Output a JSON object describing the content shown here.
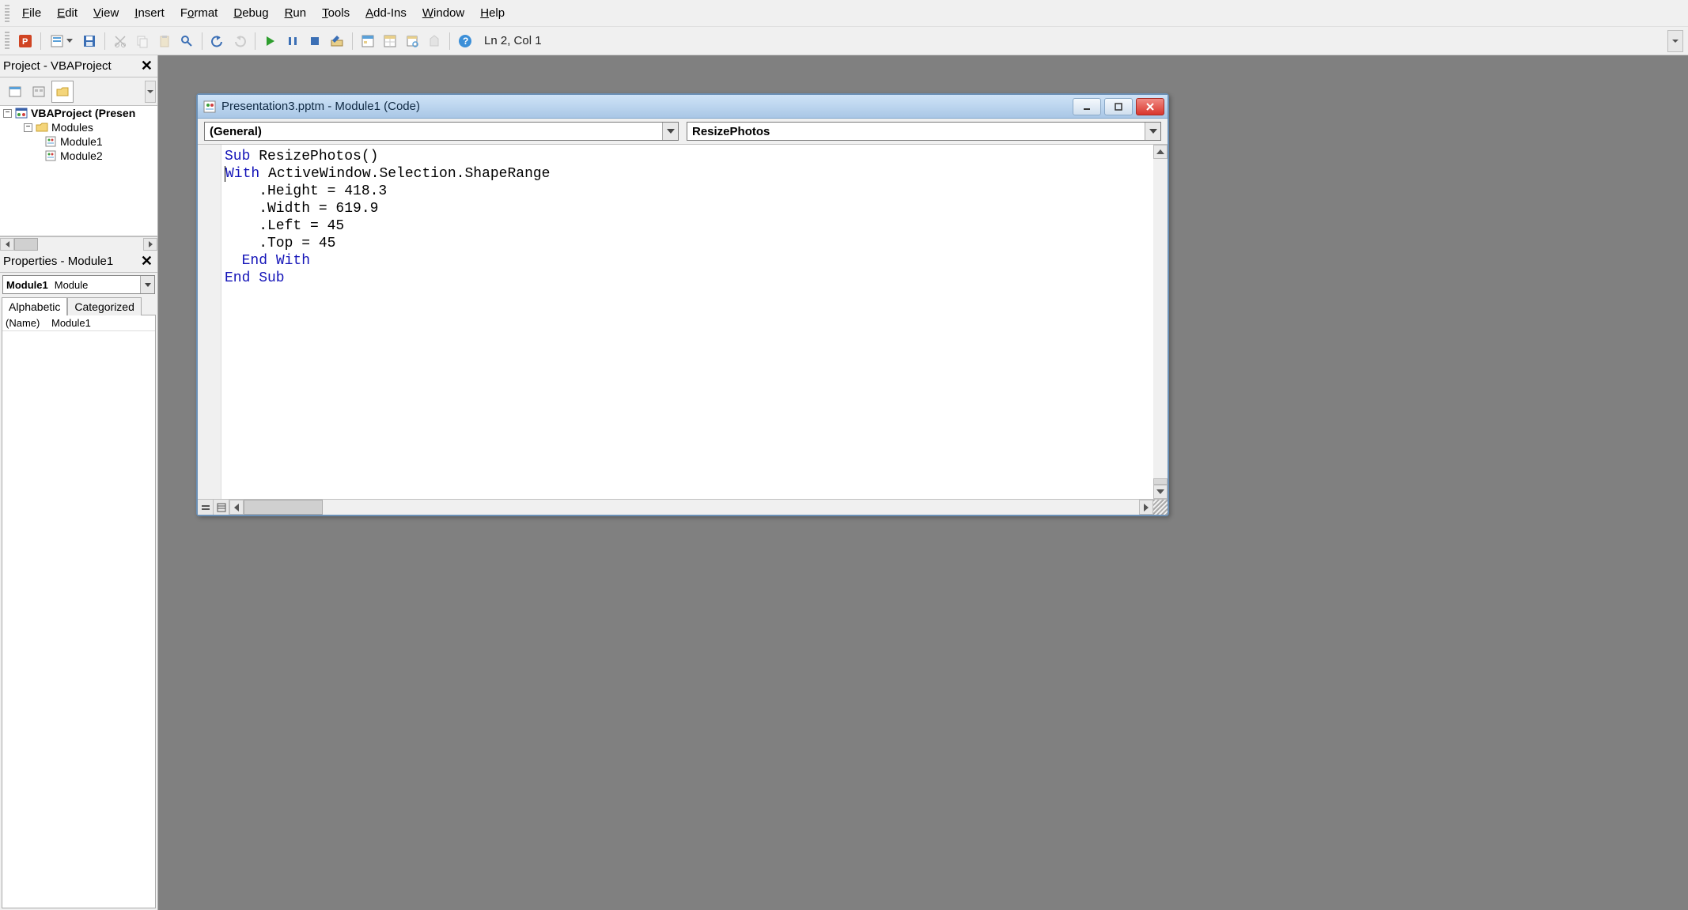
{
  "menu": {
    "file": "File",
    "edit": "Edit",
    "view": "View",
    "insert": "Insert",
    "format": "Format",
    "debug": "Debug",
    "run": "Run",
    "tools": "Tools",
    "addins": "Add-Ins",
    "window": "Window",
    "help": "Help"
  },
  "toolbar": {
    "status": "Ln 2, Col 1"
  },
  "project_panel": {
    "title": "Project - VBAProject",
    "tree": {
      "root": "VBAProject (Presen",
      "folder": "Modules",
      "module1": "Module1",
      "module2": "Module2"
    }
  },
  "properties_panel": {
    "title": "Properties - Module1",
    "object_name": "Module1",
    "object_type": "Module",
    "tabs": {
      "alphabetic": "Alphabetic",
      "categorized": "Categorized"
    },
    "rows": [
      {
        "name": "(Name)",
        "value": "Module1"
      }
    ]
  },
  "code_window": {
    "title": "Presentation3.pptm - Module1 (Code)",
    "combo_left": "(General)",
    "combo_right": "ResizePhotos",
    "code": {
      "l1a": "Sub",
      "l1b": " ResizePhotos()",
      "l2a": "With",
      "l2b": " ActiveWindow.Selection.ShapeRange",
      "l3": "    .Height = 418.3",
      "l4": "    .Width = 619.9",
      "l5": "    .Left = 45",
      "l6": "    .Top = 45",
      "l7a": "  ",
      "l7b": "End With",
      "l8": "End Sub"
    }
  }
}
